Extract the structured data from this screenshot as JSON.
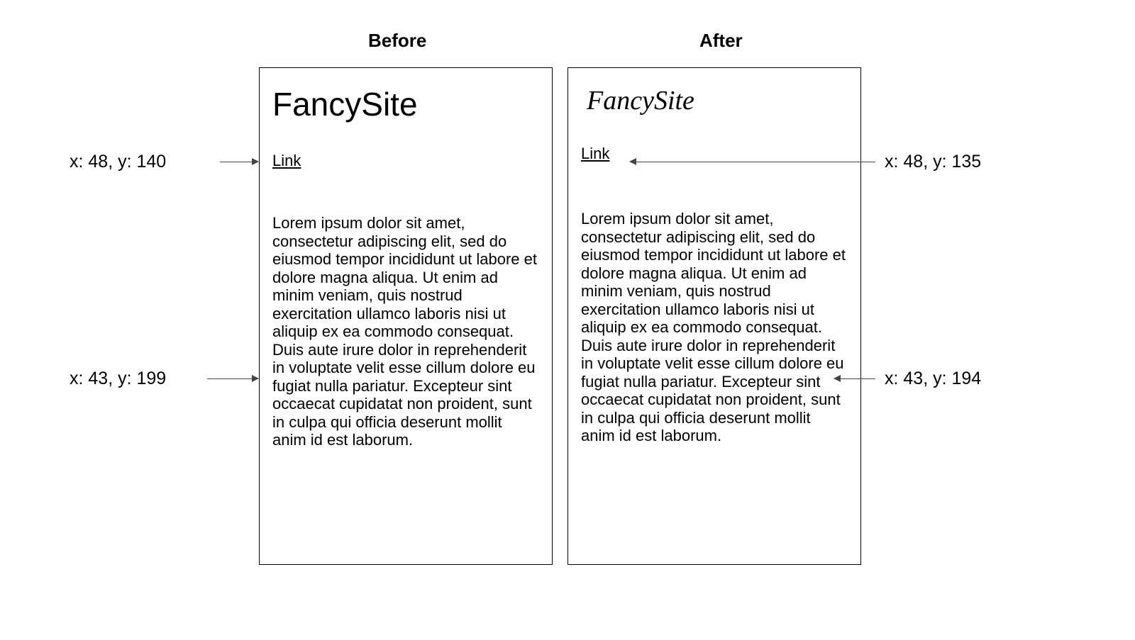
{
  "headings": {
    "before": "Before",
    "after": "After"
  },
  "site_title": "FancySite",
  "link_label": "Link",
  "body_text": "Lorem ipsum dolor sit amet, consectetur adipiscing elit, sed do eiusmod tempor incididunt ut labore et dolore magna aliqua. Ut enim ad minim veniam, quis nostrud exercitation ullamco laboris nisi ut aliquip ex ea commodo consequat. Duis aute irure dolor in reprehenderit in voluptate velit esse cillum dolore eu fugiat nulla pariatur. Excepteur sint occaecat cupidatat non proident, sunt in culpa qui officia deserunt mollit anim id est laborum.",
  "annotations": {
    "before_link": "x: 48, y: 140",
    "before_body": "x: 43, y: 199",
    "after_link": "x: 48, y: 135",
    "after_body": "x: 43, y: 194"
  }
}
